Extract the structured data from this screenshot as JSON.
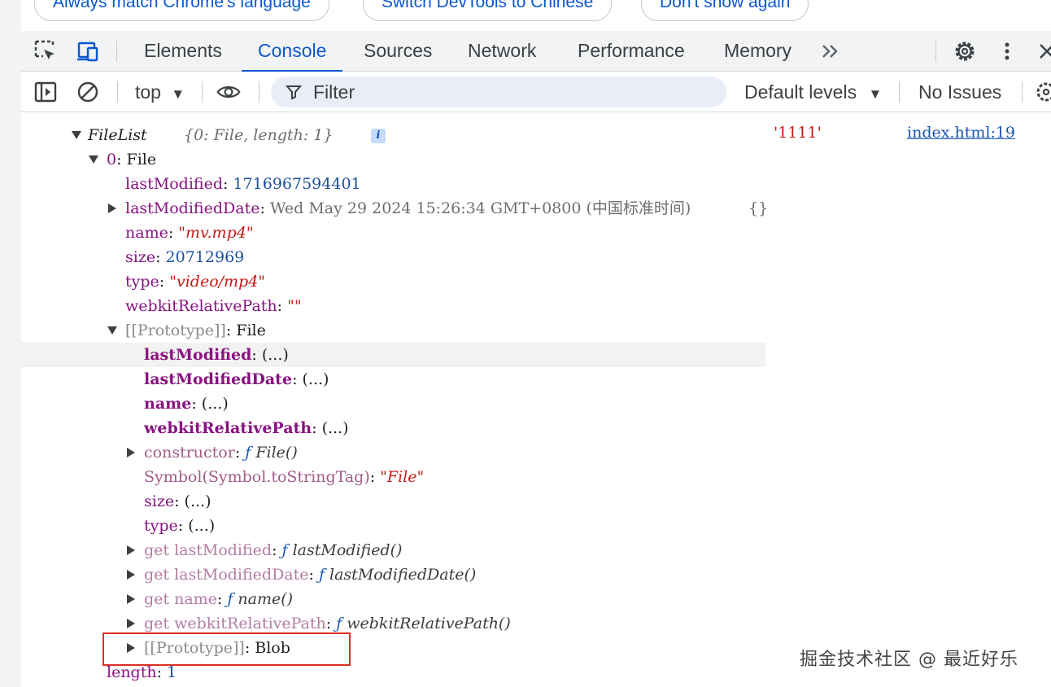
{
  "banner": {
    "buttons": [
      "Always match Chrome's language",
      "Switch DevTools to Chinese",
      "Don't show again"
    ]
  },
  "tabs": [
    "Elements",
    "Console",
    "Sources",
    "Network",
    "Performance",
    "Memory"
  ],
  "active_tab": "Console",
  "toolbar": {
    "context": "top",
    "filter_placeholder": "Filter",
    "levels": "Default levels",
    "issues": "No Issues"
  },
  "log": {
    "string_value": "'1111'",
    "source": "index.html:19",
    "filelist_label": "FileList",
    "filelist_preview": "{0: File, length: 1}",
    "info_badge": "i",
    "lines": [
      {
        "key": "0",
        "sep": ": ",
        "val": "File"
      },
      {
        "key": "lastModified",
        "sep": ": ",
        "val": "1716967594401"
      },
      {
        "key": "lastModifiedDate",
        "sep": ": ",
        "val": "Wed May 29 2024 15:26:34 GMT+0800 (中国标准时间)",
        "extra": "{}"
      },
      {
        "key": "name",
        "sep": ": ",
        "val": "\"mv.mp4\""
      },
      {
        "key": "size",
        "sep": ": ",
        "val": "20712969"
      },
      {
        "key": "type",
        "sep": ": ",
        "val": "\"video/mp4\""
      },
      {
        "key": "webkitRelativePath",
        "sep": ": ",
        "val": "\"\""
      },
      {
        "key": "[[Prototype]]",
        "sep": ": ",
        "val": "File"
      },
      {
        "key": "lastModified",
        "sep": ": ",
        "val": "(...)"
      },
      {
        "key": "lastModifiedDate",
        "sep": ": ",
        "val": "(...)"
      },
      {
        "key": "name",
        "sep": ": ",
        "val": "(...)"
      },
      {
        "key": "webkitRelativePath",
        "sep": ": ",
        "val": "(...)"
      },
      {
        "key": "constructor",
        "sep": ": ",
        "f": "ƒ",
        "val": "File()"
      },
      {
        "key": "Symbol(Symbol.toStringTag)",
        "sep": ": ",
        "val": "\"File\""
      },
      {
        "key": "size",
        "sep": ": ",
        "val": "(...)"
      },
      {
        "key": "type",
        "sep": ": ",
        "val": "(...)"
      },
      {
        "key": "get lastModified",
        "sep": ": ",
        "f": "ƒ",
        "val": "lastModified()"
      },
      {
        "key": "get lastModifiedDate",
        "sep": ": ",
        "f": "ƒ",
        "val": "lastModifiedDate()"
      },
      {
        "key": "get name",
        "sep": ": ",
        "f": "ƒ",
        "val": "name()"
      },
      {
        "key": "get webkitRelativePath",
        "sep": ": ",
        "f": "ƒ",
        "val": "webkitRelativePath()"
      },
      {
        "key": "[[Prototype]]",
        "sep": ": ",
        "val": "Blob"
      },
      {
        "key": "length",
        "sep": ": ",
        "val": "1"
      }
    ]
  },
  "watermark": "掘金技术社区 @ 最近好乐",
  "colors": {
    "accent": "#0b57d0",
    "highlight_box": "#d93025",
    "string": "#c41a16",
    "number": "#1c4f9c",
    "own_key": "#881280"
  }
}
